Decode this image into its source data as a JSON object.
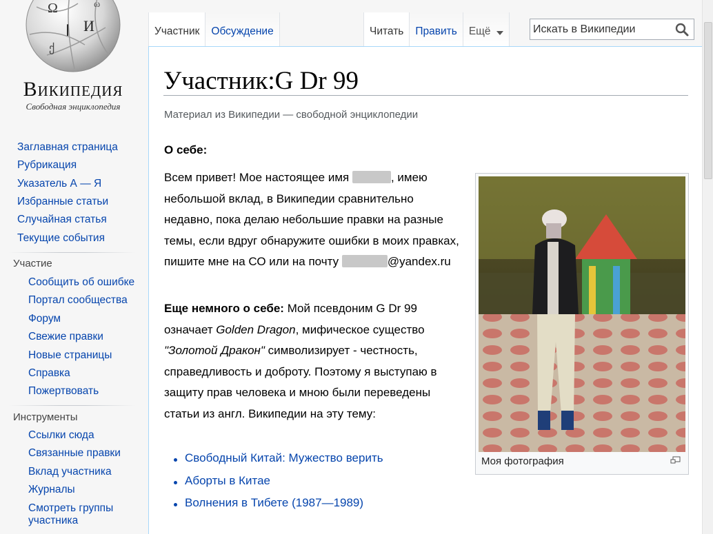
{
  "logo": {
    "wordmark": "Википедия",
    "tagline": "Свободная энциклопедия"
  },
  "sidebar": {
    "main_links": [
      "Заглавная страница",
      "Рубрикация",
      "Указатель А — Я",
      "Избранные статьи",
      "Случайная статья",
      "Текущие события"
    ],
    "participation": {
      "heading": "Участие",
      "links": [
        "Сообщить об ошибке",
        "Портал сообщества",
        "Форум",
        "Свежие правки",
        "Новые страницы",
        "Справка",
        "Пожертвовать"
      ]
    },
    "tools": {
      "heading": "Инструменты",
      "links": [
        "Ссылки сюда",
        "Связанные правки",
        "Вклад участника",
        "Журналы",
        "Смотреть группы",
        "участника"
      ]
    }
  },
  "tabs": {
    "user": "Участник",
    "discussion": "Обсуждение",
    "read": "Читать",
    "edit": "Править",
    "more": "Ещё"
  },
  "search": {
    "placeholder": "Искать в Википедии"
  },
  "content": {
    "title": "Участник:G Dr 99",
    "subtitle": "Материал из Википедии — свободной энциклопедии",
    "about_heading": "О себе:",
    "p1": {
      "before": "Всем привет! Мое настоящее имя ",
      "after": ", имею небольшой вклад, в Википедии сравнительно недавно, пока делаю небольшие правки на разные темы, если вдруг обнаружите ошибки в моих правках, пишите мне на СО или на почту ",
      "email_domain": "@yandex.ru"
    },
    "p2": {
      "bold": "Еще немного о себе:",
      "t1": " Мой псевдоним G Dr 99 означает ",
      "i1": "Golden Dragon",
      "t2": ", мифическое существо ",
      "i2": "\"Золотой Дракон\"",
      "t3": " символизирует - честность, справедливость и доброту. Поэтому я выступаю в защиту прав человека и мною были переведены статьи из англ. Википедии на эту тему:"
    },
    "articles": [
      "Свободный Китай: Мужество верить",
      "Аборты в Китае",
      "Волнения в Тибете (1987—1989)"
    ],
    "thumb_caption": "Моя фотография"
  },
  "colors": {
    "link": "#0645ad",
    "content_border": "#a7d7f9"
  }
}
